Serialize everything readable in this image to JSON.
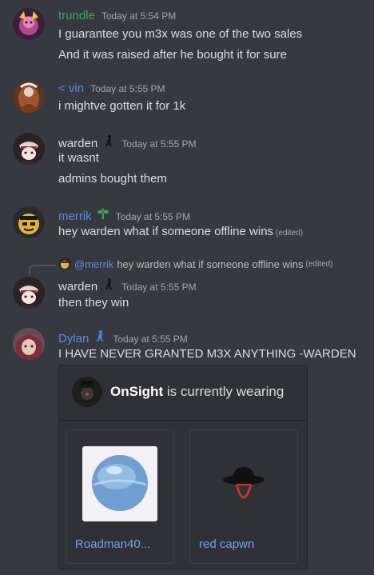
{
  "messages": [
    {
      "author": "trundle",
      "author_color": "#3ba55d",
      "timestamp": "Today at 5:54 PM",
      "lines": [
        "I guarantee you m3x was one of the two sales",
        "And it was raised after he bought it for sure"
      ]
    },
    {
      "author": "< vin",
      "author_color": "#5b8de0",
      "timestamp": "Today at 5:55 PM",
      "lines": [
        "i mightve gotten it for 1k"
      ]
    },
    {
      "author": "warden",
      "author_color": "#dcddde",
      "timestamp": "Today at 5:55 PM",
      "badge": "black-figure-icon",
      "lines": [
        "it wasnt",
        "admins bought them"
      ]
    },
    {
      "author": "merrik",
      "author_color": "#5b8de0",
      "timestamp": "Today at 5:55 PM",
      "badge": "sprout-icon",
      "lines": [
        "hey warden what if someone offline wins"
      ],
      "edited": "(edited)"
    },
    {
      "reply": {
        "mention": "@merrik",
        "text": "hey warden what if someone offline wins",
        "edited": "(edited)"
      },
      "author": "warden",
      "author_color": "#dcddde",
      "timestamp": "Today at 5:55 PM",
      "badge": "black-figure-icon",
      "lines": [
        "then they win"
      ]
    },
    {
      "author": "Dylan",
      "author_color": "#5b8de0",
      "timestamp": "Today at 5:55 PM",
      "badge": "blue-figure-icon",
      "lines": [
        "I HAVE NEVER GRANTED M3X ANYTHING -WARDEN"
      ]
    }
  ],
  "embed": {
    "title_bold": "OnSight",
    "title_rest": " is currently wearing",
    "items": [
      {
        "name": "Roadman40...",
        "icon": "blue-orb-icon"
      },
      {
        "name": "red capwn",
        "icon": "fedora-hat-icon"
      }
    ]
  }
}
